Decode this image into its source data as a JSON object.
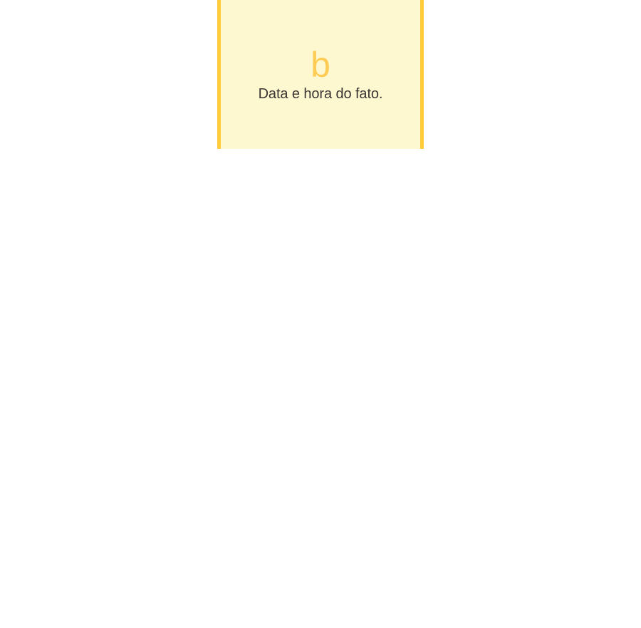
{
  "card": {
    "letter": "b",
    "description": "Data e hora do fato."
  },
  "colors": {
    "card_background": "#fef8d0",
    "card_border": "#fecc3b",
    "letter": "#fecc54",
    "text": "#3a3533",
    "page_background": "#ffffff"
  }
}
